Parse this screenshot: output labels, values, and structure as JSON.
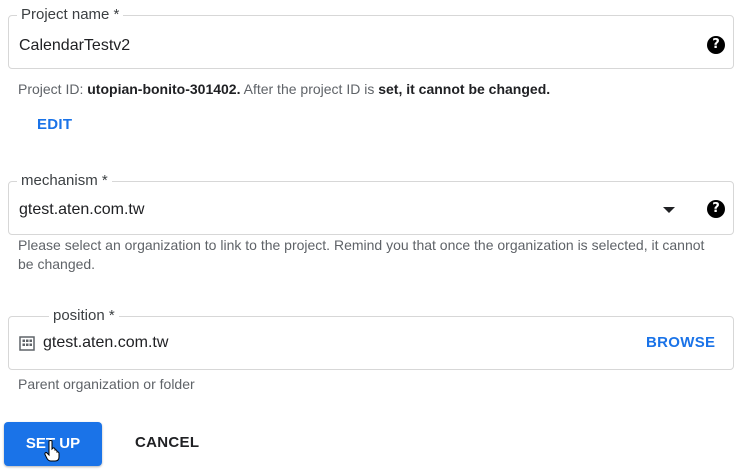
{
  "project_name": {
    "label": "Project name *",
    "value": "CalendarTestv2",
    "help_icon": "help-circle-icon"
  },
  "project_id": {
    "prefix": "Project ID: ",
    "id": "utopian-bonito-301402.",
    "middle": " After the project ID is ",
    "suffix": "set, it cannot be changed.",
    "edit_label": "EDIT"
  },
  "mechanism": {
    "label": "mechanism *",
    "value": "gtest.aten.com.tw",
    "hint": "Please select an organization to link to the project. Remind you that once the organization is selected, it cannot be changed.",
    "dropdown_icon": "dropdown-arrow-icon",
    "help_icon": "help-circle-icon"
  },
  "position": {
    "label": "position *",
    "value": "gtest.aten.com.tw",
    "browse_label": "BROWSE",
    "hint": "Parent organization or folder",
    "org_icon": "building-icon"
  },
  "actions": {
    "setup_label": "SET UP",
    "cancel_label": "CANCEL"
  },
  "colors": {
    "accent": "#1a73e8",
    "border": "#d7d7d7",
    "hint_text": "#5f6368"
  }
}
